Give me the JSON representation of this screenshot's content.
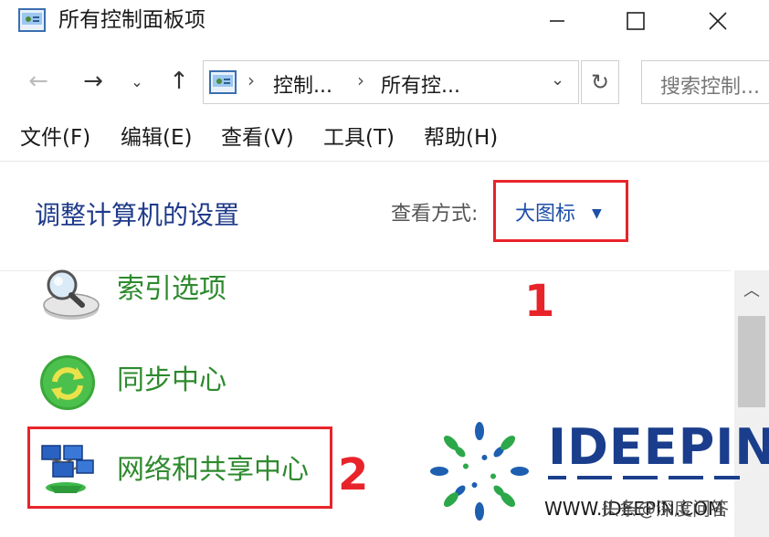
{
  "window": {
    "title": "所有控制面板项",
    "min_icon": "minimize-icon",
    "max_icon": "maximize-icon",
    "close_icon": "close-icon"
  },
  "nav": {
    "back_icon": "←",
    "forward_icon": "→",
    "recent_icon": "⌄",
    "up_icon": "↑",
    "breadcrumbs": [
      "控制...",
      "所有控..."
    ],
    "separator": "›",
    "dropdown_icon": "⌄",
    "refresh_icon": "↻",
    "search_placeholder": "搜索控制..."
  },
  "menu": {
    "items": [
      "文件(F)",
      "编辑(E)",
      "查看(V)",
      "工具(T)",
      "帮助(H)"
    ]
  },
  "content": {
    "heading": "调整计算机的设置",
    "view_by_label": "查看方式:",
    "view_by_value": "大图标",
    "caret": "▼",
    "annotations": [
      "1",
      "2"
    ],
    "items": [
      {
        "label": "索引选项",
        "icon": "index-options-icon"
      },
      {
        "label": "同步中心",
        "icon": "sync-center-icon"
      },
      {
        "label": "网络和共享中心",
        "icon": "network-sharing-icon"
      }
    ]
  },
  "scrollbar": {
    "up_icon": "︿"
  },
  "watermark": {
    "brand": "IDEEPIN",
    "subtitle": "WWW.IDEEPIN.COM",
    "overlay": "头条@深度问答"
  },
  "colors": {
    "heading": "#1e3a8a",
    "link_green": "#2e8a2e",
    "annotation_red": "#e8242a",
    "brand_blue": "#1a3e8c"
  }
}
